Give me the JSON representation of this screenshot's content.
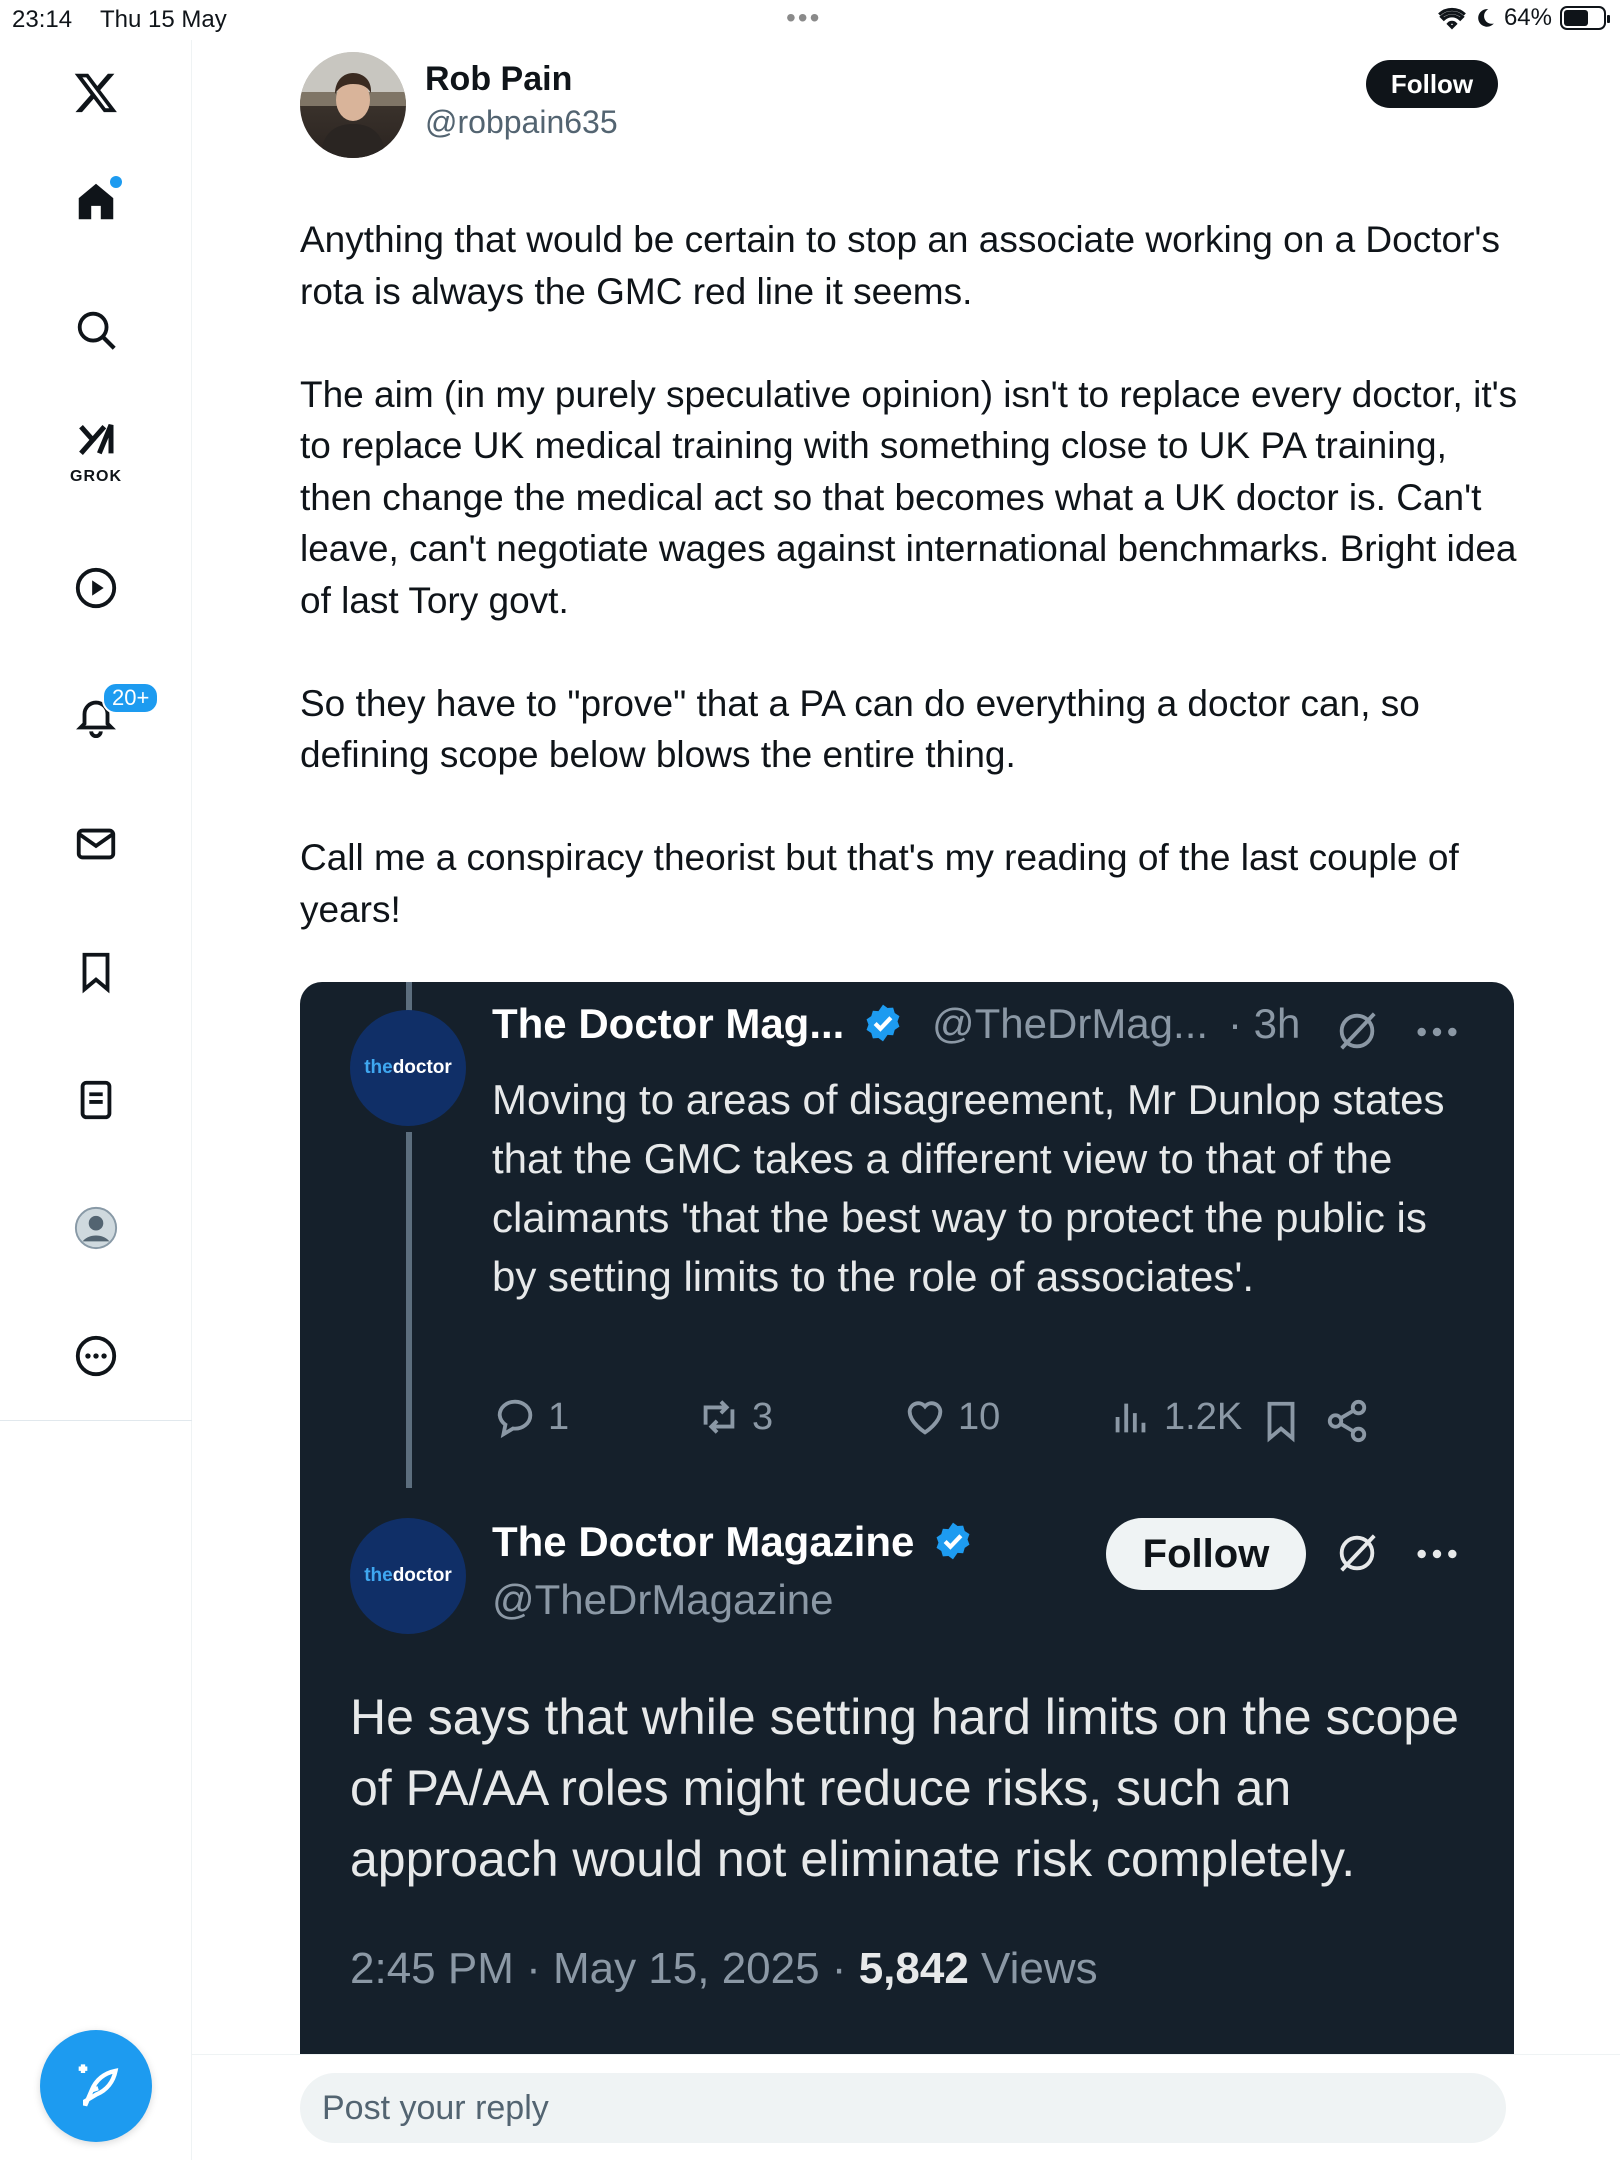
{
  "status_bar": {
    "time": "23:14",
    "date": "Thu 15 May",
    "battery": "64%",
    "battery_level": 0.64
  },
  "sidebar": {
    "grok_label": "GROK",
    "notifications_badge": "20+",
    "items": [
      "x-logo",
      "home",
      "search",
      "grok",
      "video",
      "notifications",
      "messages",
      "bookmarks",
      "lists",
      "profile",
      "more"
    ]
  },
  "post": {
    "author_name": "Rob Pain",
    "author_handle": "@robpain635",
    "follow_label": "Follow",
    "paragraphs": [
      "Anything that would be certain to stop an associate working on a Doctor's rota is always the GMC red line it seems.",
      "The aim (in my purely speculative opinion) isn't to replace every doctor, it's to replace UK medical training with something close to UK PA training, then change the medical act so that becomes what a UK doctor is. Can't leave, can't negotiate wages against international benchmarks. Bright idea of last Tory govt.",
      "So they have to \"prove\" that a PA can do everything a doctor can, so defining scope below blows the entire thing.",
      "Call me a conspiracy theorist but that's my reading of the last couple of years!"
    ]
  },
  "embed": {
    "avatar_the": "the",
    "avatar_doctor": "doctor",
    "tweet1": {
      "name": "The Doctor Mag...",
      "handle": "@TheDrMag...",
      "time": "· 3h",
      "text": "Moving to areas of disagreement, Mr Dunlop states that the GMC takes a different view to that of the claimants 'that the best way to protect the public is by setting limits to the role of associates'.",
      "replies": "1",
      "reposts": "3",
      "likes": "10",
      "views": "1.2K"
    },
    "tweet2": {
      "name": "The Doctor Magazine",
      "handle": "@TheDrMagazine",
      "follow_label": "Follow",
      "text": "He says that while setting hard limits on the scope of PA/AA roles might reduce risks, such an approach would not eliminate risk completely.",
      "timestamp": "2:45 PM · May 15, 2025 · ",
      "views_count": "5,842",
      "views_label": " Views"
    }
  },
  "reply": {
    "placeholder": "Post your reply"
  },
  "colors": {
    "accent": "#1d9bf0",
    "dark_bg": "#15202b"
  }
}
